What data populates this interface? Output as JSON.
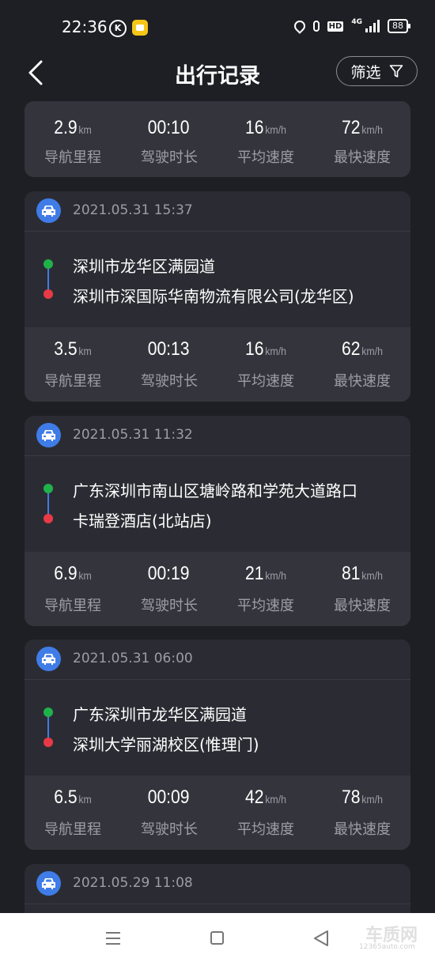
{
  "status_bar": {
    "time": "22:36",
    "k_badge": "K",
    "network": "4G",
    "hd": "HD",
    "battery": "88",
    "icons": [
      "location-icon",
      "mic-icon",
      "hd-icon",
      "signal-icon",
      "battery-icon"
    ]
  },
  "header": {
    "title": "出行记录",
    "filter_label": "筛选",
    "back_icon": "chevron-left-icon",
    "filter_icon": "funnel-icon"
  },
  "colors": {
    "background": "#1e1f24",
    "card": "#2b2c33",
    "stats_bg": "#34353c",
    "accent_blue": "#3f7ce8",
    "start_green": "#1fb24a",
    "end_red": "#e83a46",
    "muted_text": "#9c9ea5"
  },
  "partial_trip": {
    "stats": [
      {
        "value": "2.9",
        "unit": "km",
        "label": "导航里程"
      },
      {
        "value": "00:10",
        "unit": "",
        "label": "驾驶时长"
      },
      {
        "value": "16",
        "unit": "km/h",
        "label": "平均速度"
      },
      {
        "value": "72",
        "unit": "km/h",
        "label": "最快速度"
      }
    ]
  },
  "trips": [
    {
      "time": "2021.05.31 15:37",
      "start": "深圳市龙华区满园道",
      "end": "深圳市深国际华南物流有限公司(龙华区)",
      "stats": [
        {
          "value": "3.5",
          "unit": "km",
          "label": "导航里程"
        },
        {
          "value": "00:13",
          "unit": "",
          "label": "驾驶时长"
        },
        {
          "value": "16",
          "unit": "km/h",
          "label": "平均速度"
        },
        {
          "value": "62",
          "unit": "km/h",
          "label": "最快速度"
        }
      ]
    },
    {
      "time": "2021.05.31 11:32",
      "start": "广东深圳市南山区塘岭路和学苑大道路口",
      "end": "卡瑞登酒店(北站店)",
      "stats": [
        {
          "value": "6.9",
          "unit": "km",
          "label": "导航里程"
        },
        {
          "value": "00:19",
          "unit": "",
          "label": "驾驶时长"
        },
        {
          "value": "21",
          "unit": "km/h",
          "label": "平均速度"
        },
        {
          "value": "81",
          "unit": "km/h",
          "label": "最快速度"
        }
      ]
    },
    {
      "time": "2021.05.31 06:00",
      "start": "广东深圳市龙华区满园道",
      "end": "深圳大学丽湖校区(惟理门)",
      "stats": [
        {
          "value": "6.5",
          "unit": "km",
          "label": "导航里程"
        },
        {
          "value": "00:09",
          "unit": "",
          "label": "驾驶时长"
        },
        {
          "value": "42",
          "unit": "km/h",
          "label": "平均速度"
        },
        {
          "value": "78",
          "unit": "km/h",
          "label": "最快速度"
        }
      ]
    },
    {
      "time": "2021.05.29 11:08"
    }
  ],
  "nav_bar": {
    "menu_icon": "menu-icon",
    "home_icon": "home-square-icon",
    "back_icon": "back-triangle-icon"
  },
  "watermark": {
    "main": "车质网",
    "sub": "12365auto.com"
  }
}
